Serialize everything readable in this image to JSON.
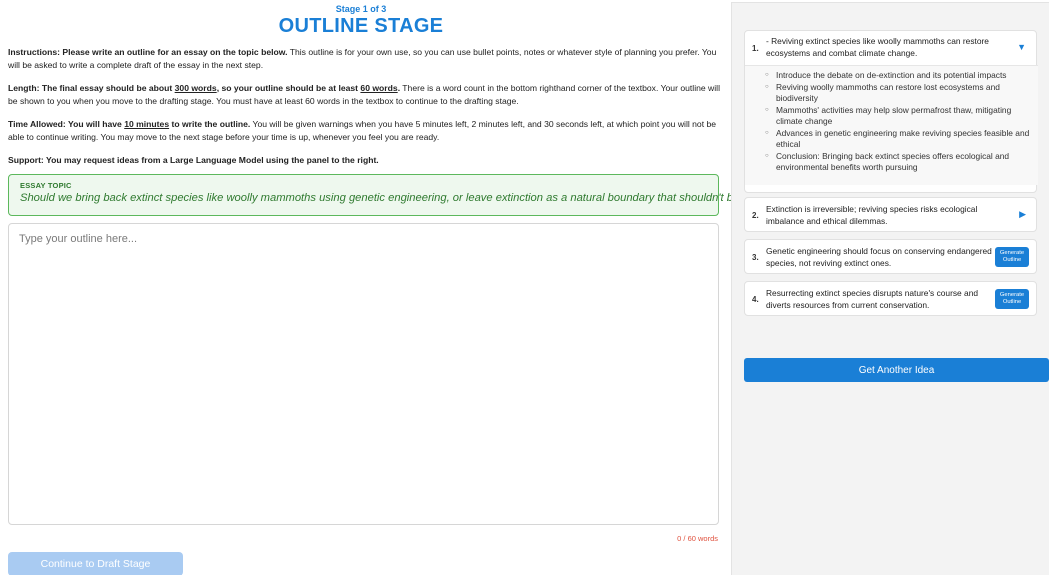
{
  "header": {
    "stage_label": "Stage 1 of 3",
    "title": "OUTLINE STAGE"
  },
  "instructions": {
    "lead": "Instructions: Please write an outline for an essay on the topic below.",
    "body": " This outline is for your own use, so you can use bullet points, notes or whatever style of planning you prefer. You will be asked to write a complete draft of the essay in the next step."
  },
  "length": {
    "lead_a": "Length: The final essay should be about ",
    "words_target": "300 words",
    "lead_b": ", so your outline should be at least ",
    "outline_min": "60 words",
    "lead_c": ".",
    "body": " There is a word count in the bottom righthand corner of the textbox. Your outline will be shown to you when you move to the drafting stage. You must have at least 60 words in the textbox to continue to the drafting stage."
  },
  "time": {
    "lead_a": "Time Allowed: You will have ",
    "minutes": "10 minutes",
    "lead_b": " to write the outline.",
    "body": " You will be given warnings when you have 5 minutes left, 2 minutes left, and 30 seconds left, at which point you will not be able to continue writing. You may move to the next stage before your time is up, whenever you feel you are ready."
  },
  "support": {
    "text": "Support: You may request ideas from a Large Language Model using the panel to the right."
  },
  "topic": {
    "label": "ESSAY TOPIC",
    "text": "Should we bring back extinct species like woolly mammoths using genetic engineering, or leave extinction as a natural boundary that shouldn't be crossed?"
  },
  "editor": {
    "placeholder": "Type your outline here...",
    "value": "",
    "word_count": "0 / 60 words"
  },
  "continue_button": "Continue to Draft Stage",
  "ideas": [
    {
      "num": "1.",
      "title": "- Reviving extinct species like woolly mammoths can restore ecosystems and combat climate change.",
      "control": "expanded-arrow",
      "arrow": "▼",
      "bullets": [
        "Introduce the debate on de-extinction and its potential impacts",
        "Reviving woolly mammoths can restore lost ecosystems and biodiversity",
        "Mammoths' activities may help slow permafrost thaw, mitigating climate change",
        "Advances in genetic engineering make reviving species feasible and ethical",
        "Conclusion: Bringing back extinct species offers ecological and environmental benefits worth pursuing"
      ]
    },
    {
      "num": "2.",
      "title": "Extinction is irreversible; reviving species risks ecological imbalance and ethical dilemmas.",
      "control": "collapsed-arrow",
      "arrow": "▶"
    },
    {
      "num": "3.",
      "title": "Genetic engineering should focus on conserving endangered species, not reviving extinct ones.",
      "control": "generate-button",
      "button": "Generate Outline"
    },
    {
      "num": "4.",
      "title": "Resurrecting extinct species disrupts nature's course and diverts resources from current conservation.",
      "control": "generate-button",
      "button": "Generate Outline"
    }
  ],
  "another_idea_button": "Get Another Idea",
  "colors": {
    "accent": "#1a7fd6",
    "topic_border": "#5cb85c",
    "topic_text": "#2f7a2f",
    "word_count": "#e0523f",
    "disabled_button": "#a9cbf2"
  }
}
